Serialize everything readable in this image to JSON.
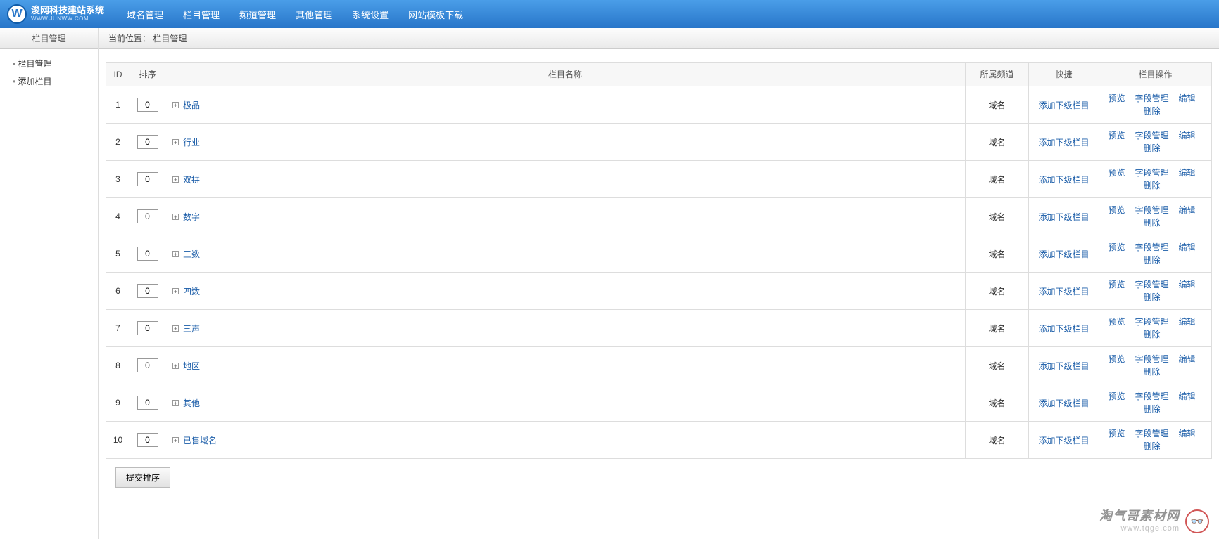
{
  "brand": {
    "name": "浚网科技建站系统",
    "sub": "WWW.JUNWW.COM"
  },
  "topnav": [
    "域名管理",
    "栏目管理",
    "频道管理",
    "其他管理",
    "系统设置",
    "网站模板下载"
  ],
  "sidebar": {
    "heading": "栏目管理",
    "items": [
      "栏目管理",
      "添加栏目"
    ]
  },
  "breadcrumb": {
    "label": "当前位置：",
    "path": "栏目管理"
  },
  "table": {
    "headers": {
      "id": "ID",
      "sort": "排序",
      "name": "栏目名称",
      "channel": "所属频道",
      "quick": "快捷",
      "ops": "栏目操作"
    },
    "quick_label": "添加下级栏目",
    "ops_labels": {
      "preview": "预览",
      "fields": "字段管理",
      "edit": "编辑",
      "delete": "删除"
    },
    "rows": [
      {
        "id": "1",
        "sort": "0",
        "name": "极品",
        "channel": "域名"
      },
      {
        "id": "2",
        "sort": "0",
        "name": "行业",
        "channel": "域名"
      },
      {
        "id": "3",
        "sort": "0",
        "name": "双拼",
        "channel": "域名"
      },
      {
        "id": "4",
        "sort": "0",
        "name": "数字",
        "channel": "域名"
      },
      {
        "id": "5",
        "sort": "0",
        "name": "三数",
        "channel": "域名"
      },
      {
        "id": "6",
        "sort": "0",
        "name": "四数",
        "channel": "域名"
      },
      {
        "id": "7",
        "sort": "0",
        "name": "三声",
        "channel": "域名"
      },
      {
        "id": "8",
        "sort": "0",
        "name": "地区",
        "channel": "域名"
      },
      {
        "id": "9",
        "sort": "0",
        "name": "其他",
        "channel": "域名"
      },
      {
        "id": "10",
        "sort": "0",
        "name": "已售域名",
        "channel": "域名"
      }
    ]
  },
  "submit_label": "提交排序",
  "watermark": {
    "title": "淘气哥素材网",
    "url": "www.tqge.com"
  }
}
